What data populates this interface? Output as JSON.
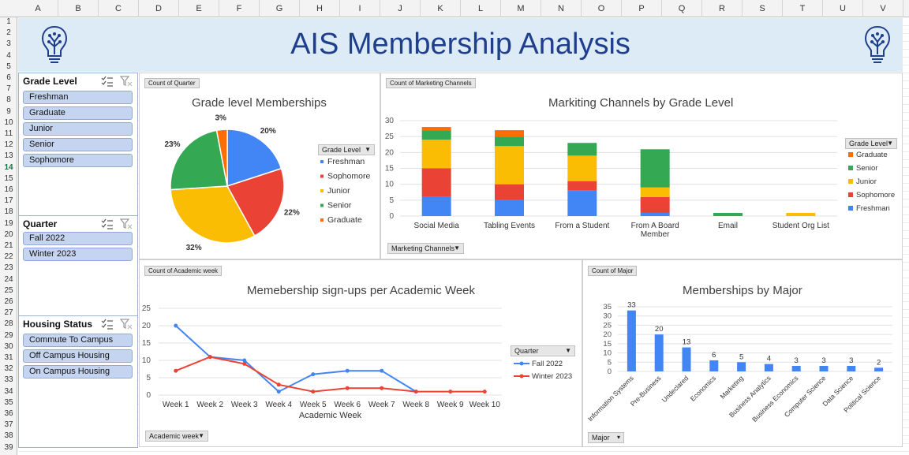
{
  "sheet": {
    "columns": [
      "A",
      "B",
      "C",
      "D",
      "E",
      "F",
      "G",
      "H",
      "I",
      "J",
      "K",
      "L",
      "M",
      "N",
      "O",
      "P",
      "Q",
      "R",
      "S",
      "T",
      "U",
      "V"
    ],
    "rows": [
      "1",
      "2",
      "3",
      "4",
      "5",
      "6",
      "7",
      "8",
      "9",
      "10",
      "11",
      "12",
      "13",
      "14",
      "15",
      "16",
      "17",
      "18",
      "19",
      "20",
      "21",
      "22",
      "23",
      "24",
      "25",
      "26",
      "27",
      "28",
      "29",
      "30",
      "31",
      "32",
      "33",
      "34",
      "35",
      "36",
      "37",
      "38",
      "39"
    ],
    "selected_row": "14"
  },
  "banner": {
    "title": "AIS Membership Analysis"
  },
  "slicers": [
    {
      "title": "Grade Level",
      "items": [
        "Freshman",
        "Graduate",
        "Junior",
        "Senior",
        "Sophomore"
      ]
    },
    {
      "title": "Quarter",
      "items": [
        "Fall 2022",
        "Winter 2023"
      ]
    },
    {
      "title": "Housing Status",
      "items": [
        "Commute To Campus",
        "Off Campus Housing",
        "On Campus Housing"
      ]
    }
  ],
  "pie": {
    "field_button": "Count of Quarter",
    "legend_dropdown": "Grade Level",
    "chart_data": {
      "type": "pie",
      "title": "Grade level Memberships",
      "categories": [
        "Freshman",
        "Sophomore",
        "Junior",
        "Senior",
        "Graduate"
      ],
      "values": [
        20,
        22,
        32,
        23,
        3
      ],
      "labels": [
        "20%",
        "22%",
        "32%",
        "23%",
        "3%"
      ],
      "colors": [
        "#4285f4",
        "#ea4335",
        "#fbbc04",
        "#34a853",
        "#ff6d01"
      ],
      "legend": "right"
    }
  },
  "marketing": {
    "field_button": "Count of Marketing Channels",
    "axis_dropdown": "Marketing Channels",
    "legend_dropdown": "Grade Level",
    "chart_data": {
      "type": "bar",
      "stacked": true,
      "title": "Markiting Channels by Grade Level",
      "categories": [
        "Social Media",
        "Tabling Events",
        "From a Student",
        "From A Board Member",
        "Email",
        "Student Org List"
      ],
      "series": [
        {
          "name": "Freshman",
          "color": "#4285f4",
          "values": [
            6,
            5,
            8,
            1,
            0,
            0
          ]
        },
        {
          "name": "Sophomore",
          "color": "#ea4335",
          "values": [
            9,
            5,
            3,
            5,
            0,
            0
          ]
        },
        {
          "name": "Junior",
          "color": "#fbbc04",
          "values": [
            9,
            12,
            8,
            3,
            0,
            1
          ]
        },
        {
          "name": "Senior",
          "color": "#34a853",
          "values": [
            3,
            3,
            4,
            12,
            1,
            0
          ]
        },
        {
          "name": "Graduate",
          "color": "#ff6d01",
          "values": [
            1,
            2,
            0,
            0,
            0,
            0
          ]
        }
      ],
      "legend_order": [
        "Graduate",
        "Senior",
        "Junior",
        "Sophomore",
        "Freshman"
      ],
      "ylim": [
        0,
        30
      ],
      "yticks": [
        0,
        5,
        10,
        15,
        20,
        25,
        30
      ],
      "legend": "right"
    }
  },
  "weekly": {
    "field_button": "Count of Academic week",
    "axis_dropdown": "Academic week",
    "legend_dropdown": "Quarter",
    "chart_data": {
      "type": "line",
      "title": "Memebership sign-ups per Academic Week",
      "xlabel": "Academic Week",
      "categories": [
        "Week 1",
        "Week 2",
        "Week 3",
        "Week 4",
        "Week 5",
        "Week 6",
        "Week 7",
        "Week 8",
        "Week 9",
        "Week 10"
      ],
      "series": [
        {
          "name": "Fall 2022",
          "color": "#4285f4",
          "values": [
            20,
            11,
            10,
            1,
            6,
            7,
            7,
            1,
            null,
            null
          ]
        },
        {
          "name": "Winter 2023",
          "color": "#ea4335",
          "values": [
            7,
            11,
            9,
            3,
            1,
            2,
            2,
            1,
            1,
            1
          ]
        }
      ],
      "ylim": [
        0,
        25
      ],
      "yticks": [
        0,
        5,
        10,
        15,
        20,
        25
      ],
      "legend": "right"
    }
  },
  "major": {
    "field_button": "Count of Major",
    "axis_dropdown": "Major",
    "chart_data": {
      "type": "bar",
      "title": "Memberships by Major",
      "categories": [
        "Information Systems",
        "Pre-Business",
        "Undeclared",
        "Economics",
        "Marketing",
        "Business Analytics",
        "Business Economics",
        "Computer Science",
        "Data Science",
        "Political Science"
      ],
      "values": [
        33,
        20,
        13,
        6,
        5,
        4,
        3,
        3,
        3,
        2
      ],
      "color": "#4285f4",
      "ylim": [
        0,
        35
      ],
      "yticks": [
        0,
        5,
        10,
        15,
        20,
        25,
        30,
        35
      ]
    }
  }
}
